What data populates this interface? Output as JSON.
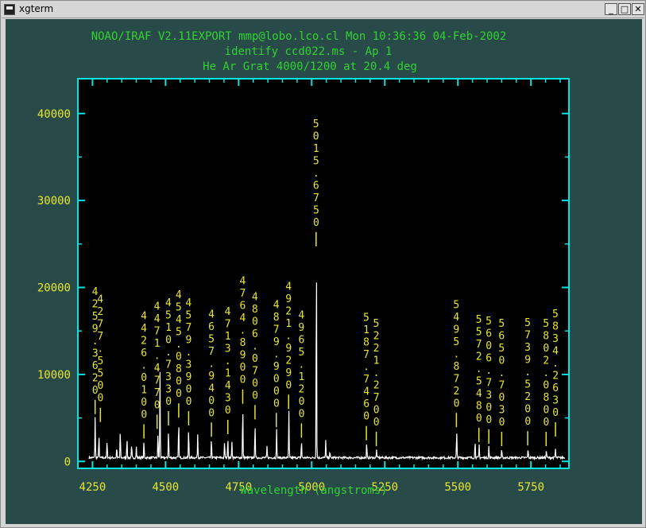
{
  "window": {
    "title": "xgterm",
    "buttons": {
      "minimize": "_",
      "maximize": "□",
      "close": "✕"
    }
  },
  "colors": {
    "header": "#32d232",
    "axis": "#00e6e6",
    "tick_labels": "#e6e632",
    "line_labels": "#e6e632",
    "spectrum": "#ffffff",
    "plot_bg": "#000000",
    "terminal_bg": "#284a48"
  },
  "header": {
    "line1": "NOAO/IRAF V2.11EXPORT mmp@lobo.lco.cl Mon 10:36:36 04-Feb-2002",
    "line2": "identify ccd022.ms - Ap 1",
    "line3": "He Ar Grat 4000/1200 at 20.4 deg"
  },
  "chart_data": {
    "type": "line",
    "title": "He Ar Grat 4000/1200 at 20.4 deg",
    "xlabel": "Wavelength (angstroms)",
    "ylabel": "",
    "xlim": [
      4200,
      5880
    ],
    "ylim": [
      -800,
      44000
    ],
    "x_ticks": [
      4250,
      4500,
      4750,
      5000,
      5250,
      5500,
      5750
    ],
    "y_ticks": [
      0,
      10000,
      20000,
      30000,
      40000
    ],
    "baseline": 300,
    "series": [
      {
        "peaks": [
          {
            "x": 4259,
            "y": 4700
          },
          {
            "x": 4272,
            "y": 2700
          },
          {
            "x": 4300,
            "y": 1900
          },
          {
            "x": 4333,
            "y": 1200
          },
          {
            "x": 4345,
            "y": 3200
          },
          {
            "x": 4368,
            "y": 2400
          },
          {
            "x": 4384,
            "y": 1400
          },
          {
            "x": 4400,
            "y": 1200
          },
          {
            "x": 4426,
            "y": 1900
          },
          {
            "x": 4474,
            "y": 3000
          },
          {
            "x": 4481,
            "y": 9800
          },
          {
            "x": 4510,
            "y": 3400
          },
          {
            "x": 4545,
            "y": 4300
          },
          {
            "x": 4579,
            "y": 3400
          },
          {
            "x": 4610,
            "y": 2700
          },
          {
            "x": 4657,
            "y": 2100
          },
          {
            "x": 4702,
            "y": 1900
          },
          {
            "x": 4713,
            "y": 2400
          },
          {
            "x": 4727,
            "y": 1900
          },
          {
            "x": 4764,
            "y": 5900
          },
          {
            "x": 4806,
            "y": 4100
          },
          {
            "x": 4847,
            "y": 1300
          },
          {
            "x": 4880,
            "y": 3200
          },
          {
            "x": 4922,
            "y": 5300
          },
          {
            "x": 4965,
            "y": 2000
          },
          {
            "x": 5016,
            "y": 24000
          },
          {
            "x": 5048,
            "y": 2000
          },
          {
            "x": 5062,
            "y": 700
          },
          {
            "x": 5188,
            "y": 1700
          },
          {
            "x": 5222,
            "y": 900
          },
          {
            "x": 5496,
            "y": 3200
          },
          {
            "x": 5559,
            "y": 2000
          },
          {
            "x": 5573,
            "y": 1500
          },
          {
            "x": 5606,
            "y": 1300
          },
          {
            "x": 5650,
            "y": 900
          },
          {
            "x": 5740,
            "y": 1100
          },
          {
            "x": 5803,
            "y": 900
          },
          {
            "x": 5834,
            "y": 1000
          }
        ]
      }
    ],
    "line_labels": [
      {
        "x": 4259,
        "text": "4259.3620"
      },
      {
        "x": 4277,
        "text": "4277.5500"
      },
      {
        "x": 4426,
        "text": "4426.0100"
      },
      {
        "x": 4471,
        "text": "4471.4770"
      },
      {
        "x": 4510,
        "text": "4510.7330"
      },
      {
        "x": 4545,
        "text": "4545.0800"
      },
      {
        "x": 4579,
        "text": "4579.3900"
      },
      {
        "x": 4657,
        "text": "4657.9400"
      },
      {
        "x": 4713,
        "text": "4713.1430"
      },
      {
        "x": 4764,
        "text": "4764.8900"
      },
      {
        "x": 4806,
        "text": "4806.0700"
      },
      {
        "x": 4879,
        "text": "4879.9000"
      },
      {
        "x": 4921,
        "text": "4921.9290"
      },
      {
        "x": 4965,
        "text": "4965.1200"
      },
      {
        "x": 5015,
        "text": "5015.6750"
      },
      {
        "x": 5187,
        "text": "5187.7460"
      },
      {
        "x": 5221,
        "text": "5221.2700"
      },
      {
        "x": 5495,
        "text": "5495.8720"
      },
      {
        "x": 5572,
        "text": "5572.5480"
      },
      {
        "x": 5606,
        "text": "5606.7300"
      },
      {
        "x": 5650,
        "text": "5650.7030"
      },
      {
        "x": 5739,
        "text": "5739.5200"
      },
      {
        "x": 5802,
        "text": "5802.0800"
      },
      {
        "x": 5834,
        "text": "5834.2630"
      }
    ]
  }
}
